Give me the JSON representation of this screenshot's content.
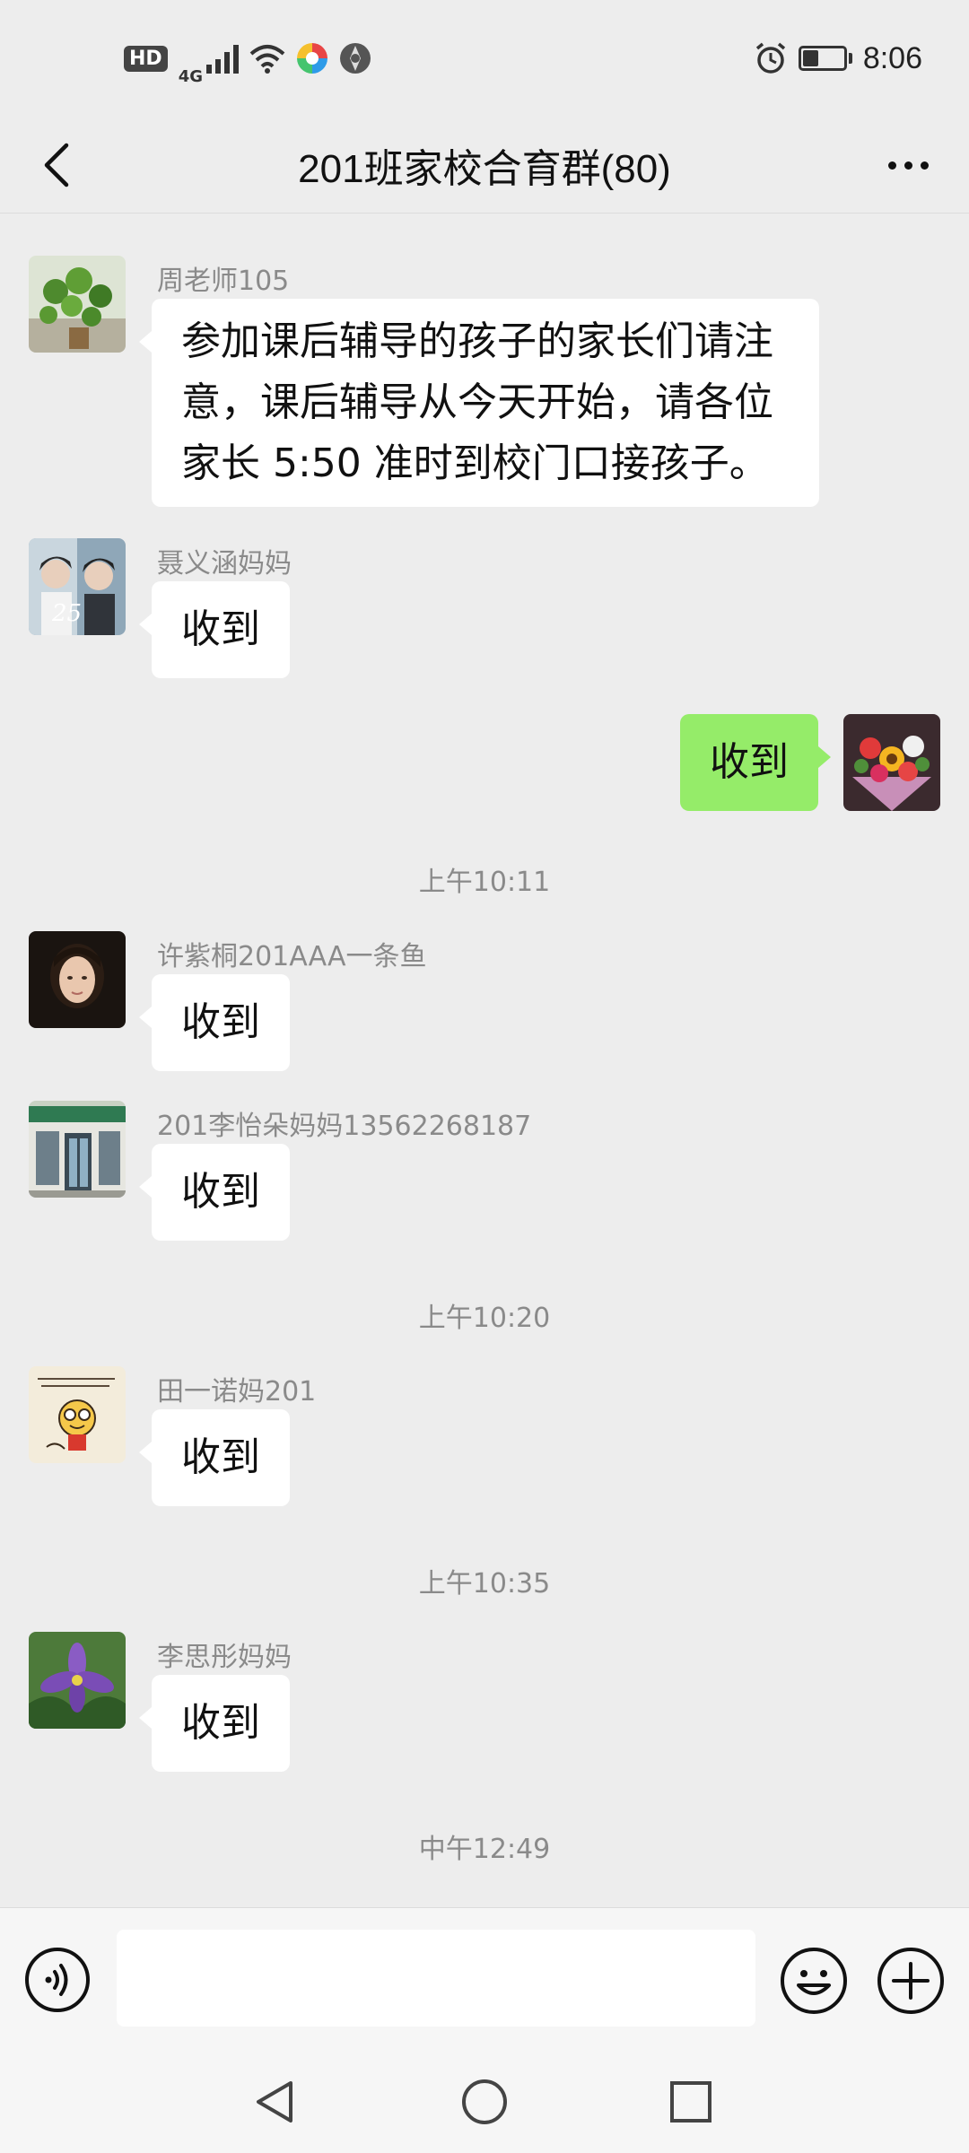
{
  "status_bar": {
    "hd": "HD",
    "network": "4G",
    "time": "8:06",
    "battery_level": 0.4
  },
  "header": {
    "title": "201班家校合育群(80)"
  },
  "messages": [
    {
      "sender": "周老师105",
      "text_lines": [
        "参加课后辅导的孩子的家长们请注",
        "意，课后辅导从今天开始，请各位",
        "家长 5:50 准时到校门口接孩子。"
      ]
    },
    {
      "sender": "聂义涵妈妈",
      "text": "收到"
    },
    {
      "sender": "",
      "text": "收到"
    },
    {
      "timestamp": "上午10:11"
    },
    {
      "sender": "许紫桐201AAA一条鱼",
      "text": "收到"
    },
    {
      "sender": "201李怡朵妈妈13562268187",
      "text": "收到"
    },
    {
      "timestamp": "上午10:20"
    },
    {
      "sender": "田一诺妈201",
      "text": "收到"
    },
    {
      "timestamp": "上午10:35"
    },
    {
      "sender": "李思彤妈妈",
      "text": "收到"
    },
    {
      "timestamp": "中午12:49"
    }
  ],
  "avatars": {
    "msg0": "potted-plant-avatar",
    "msg1": "two-men-photo-avatar",
    "self": "flower-bouquet-avatar",
    "msg4": "woman-portrait-avatar",
    "msg5": "clinic-storefront-avatar",
    "msg7": "cartoon-drawing-avatar",
    "msg9": "purple-flower-avatar"
  },
  "input": {
    "placeholder": ""
  },
  "colors": {
    "background": "#ededed",
    "self_bubble": "#95ec69",
    "other_bubble": "#ffffff",
    "meta_text": "#8a8a8a"
  }
}
